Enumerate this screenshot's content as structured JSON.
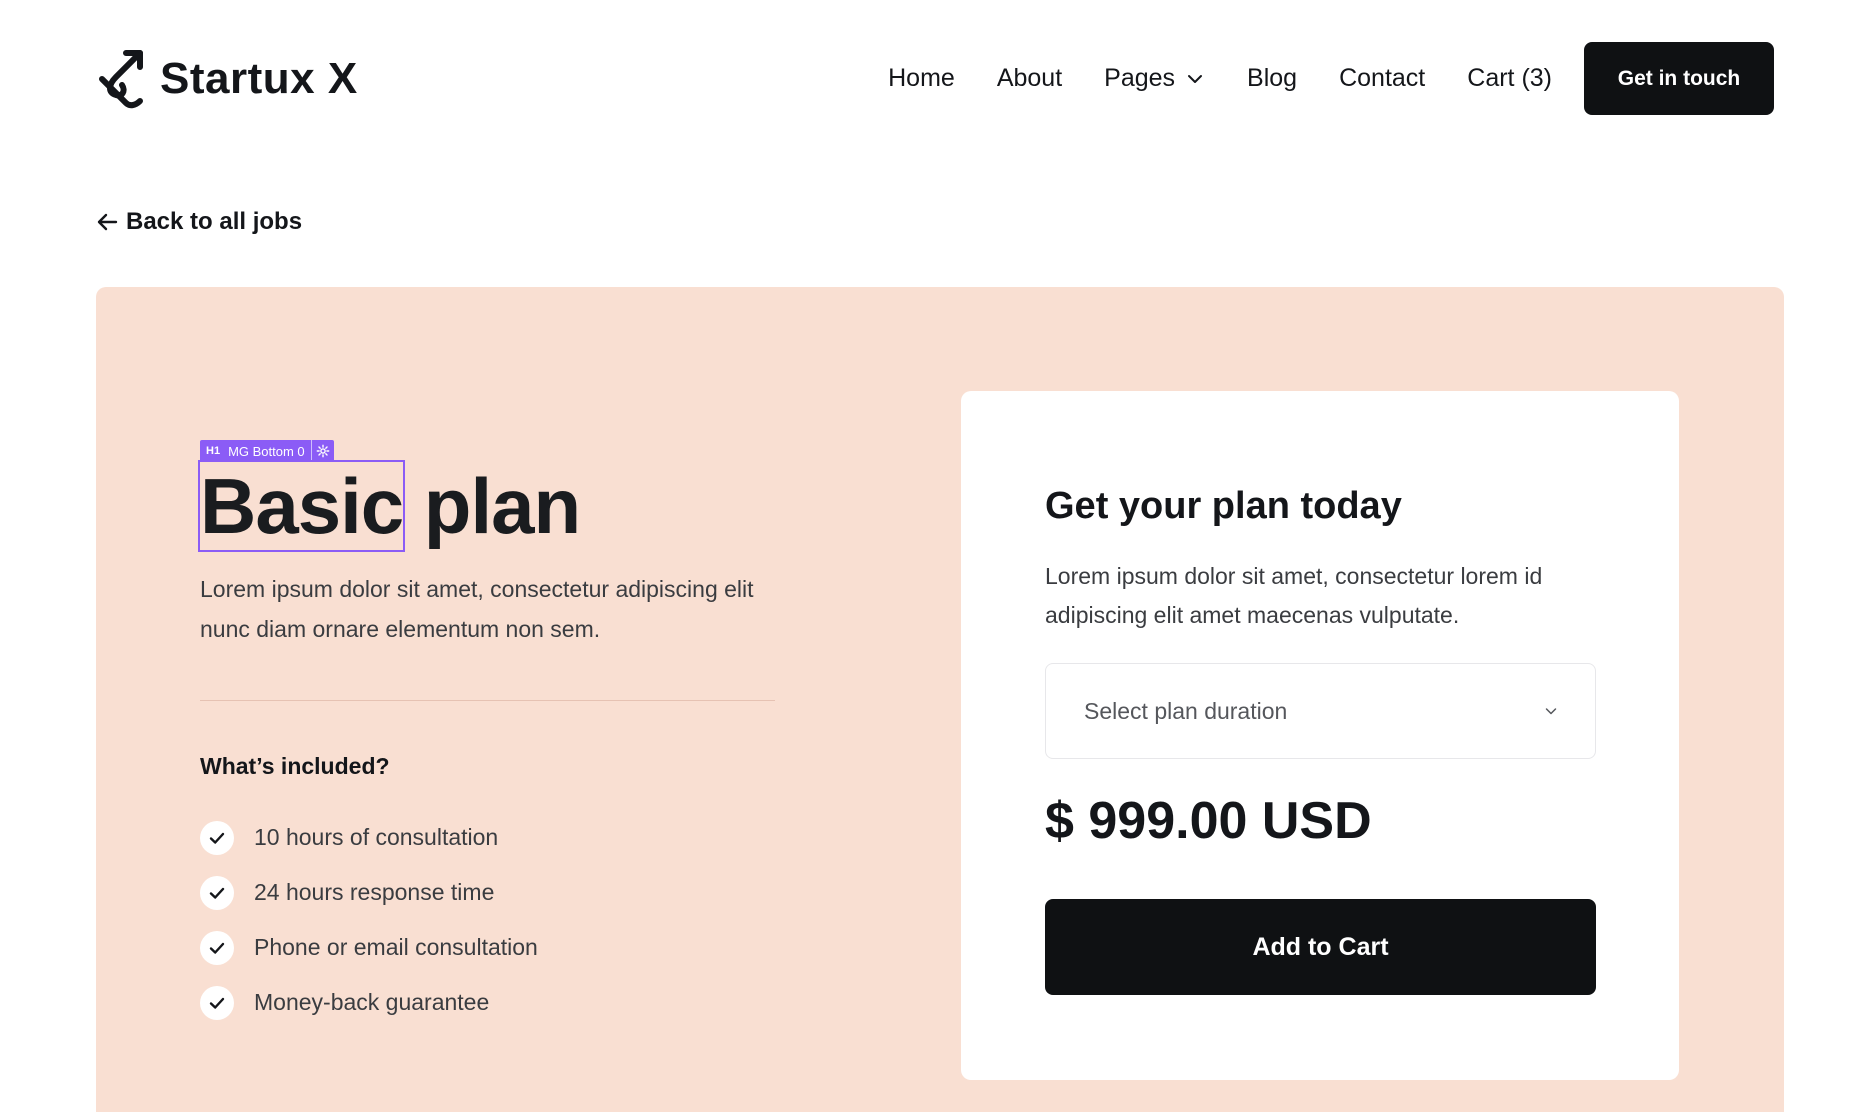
{
  "header": {
    "logo_text": "Startux X",
    "nav": {
      "home": "Home",
      "about": "About",
      "pages": "Pages",
      "blog": "Blog",
      "contact": "Contact",
      "cart": "Cart (3)"
    },
    "cta_label": "Get in touch"
  },
  "back_link": "Back to all jobs",
  "editor_tag": {
    "tag": "H1",
    "label": "MG Bottom 0"
  },
  "plan": {
    "title_selected": "Basic",
    "title_rest": " plan",
    "description": "Lorem ipsum dolor sit amet, consectetur adipiscing elit nunc diam ornare elementum non sem.",
    "included_title": "What’s included?",
    "features": [
      "10 hours of consultation",
      "24 hours response time",
      "Phone or email consultation",
      "Money-back guarantee"
    ]
  },
  "card": {
    "title": "Get your plan today",
    "description": "Lorem ipsum dolor sit amet, consectetur lorem id adipiscing elit amet maecenas vulputate.",
    "select_placeholder": "Select plan duration",
    "price": "$ 999.00 USD",
    "button_label": "Add to Cart"
  },
  "colors": {
    "panel_bg": "#f9dfd2",
    "button_bg": "#0f1113",
    "editor_accent": "#8b5cf6"
  },
  "icons": {
    "logo": "link-logo-icon",
    "pages_dropdown": "chevron-down-icon",
    "back": "arrow-left-icon",
    "feature": "check-icon",
    "select": "chevron-down-icon",
    "editor": "gear-icon"
  }
}
